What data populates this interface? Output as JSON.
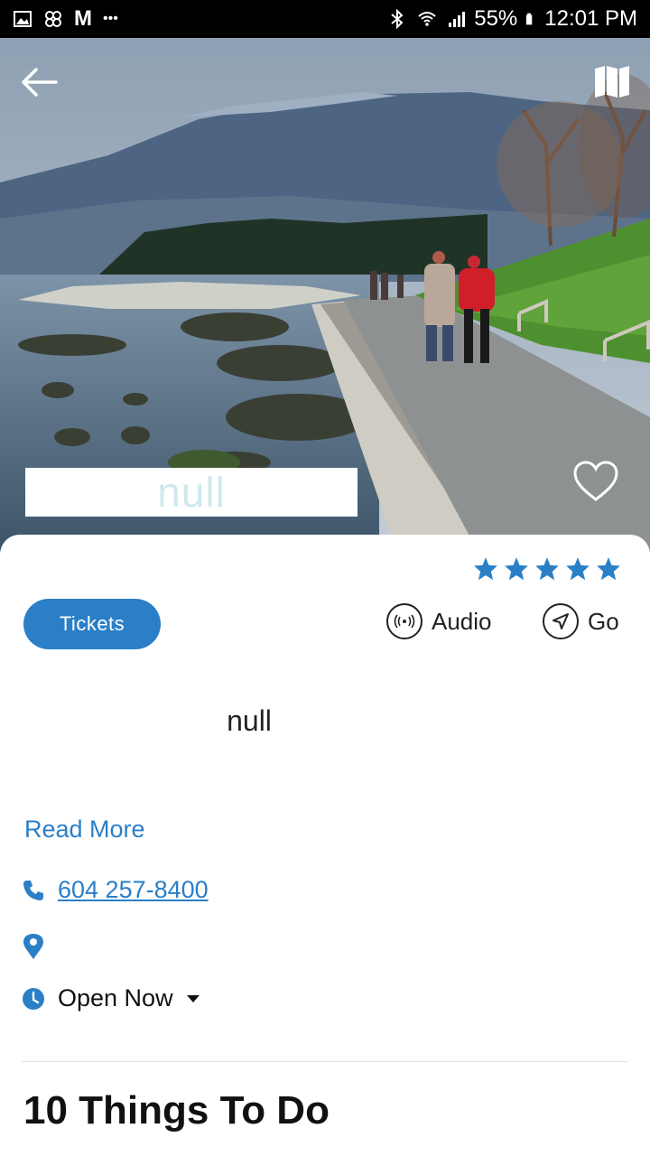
{
  "status_bar": {
    "notification_icons": [
      "image-icon",
      "pinwheel-icon",
      "gmail-icon",
      "more-dots-icon"
    ],
    "gmail_label": "M",
    "more_label": "•••",
    "battery": "55%",
    "time": "12:01 PM"
  },
  "hero": {
    "title": "null"
  },
  "rating": {
    "stars": 5,
    "max": 5,
    "color": "#2a7fc7"
  },
  "actions": {
    "tickets_label": "Tickets",
    "audio_label": "Audio",
    "go_label": "Go"
  },
  "description": "null",
  "read_more_label": "Read More",
  "contact": {
    "phone": "604 257-8400",
    "address": "",
    "hours_label": "Open Now"
  },
  "section": {
    "title": "10 Things To Do"
  },
  "colors": {
    "accent": "#2a7fc7",
    "status_bar": "#000000"
  }
}
